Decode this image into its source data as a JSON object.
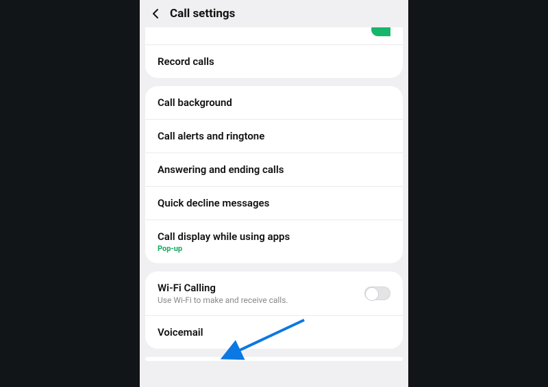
{
  "header": {
    "title": "Call settings"
  },
  "card1": {
    "record_calls": "Record calls"
  },
  "card2": {
    "call_background": "Call background",
    "call_alerts": "Call alerts and ringtone",
    "answering": "Answering and ending calls",
    "quick_decline": "Quick decline messages",
    "call_display": "Call display while using apps",
    "call_display_sub": "Pop-up"
  },
  "card3": {
    "wifi_calling": "Wi-Fi Calling",
    "wifi_calling_sub": "Use Wi-Fi to make and receive calls.",
    "voicemail": "Voicemail"
  }
}
